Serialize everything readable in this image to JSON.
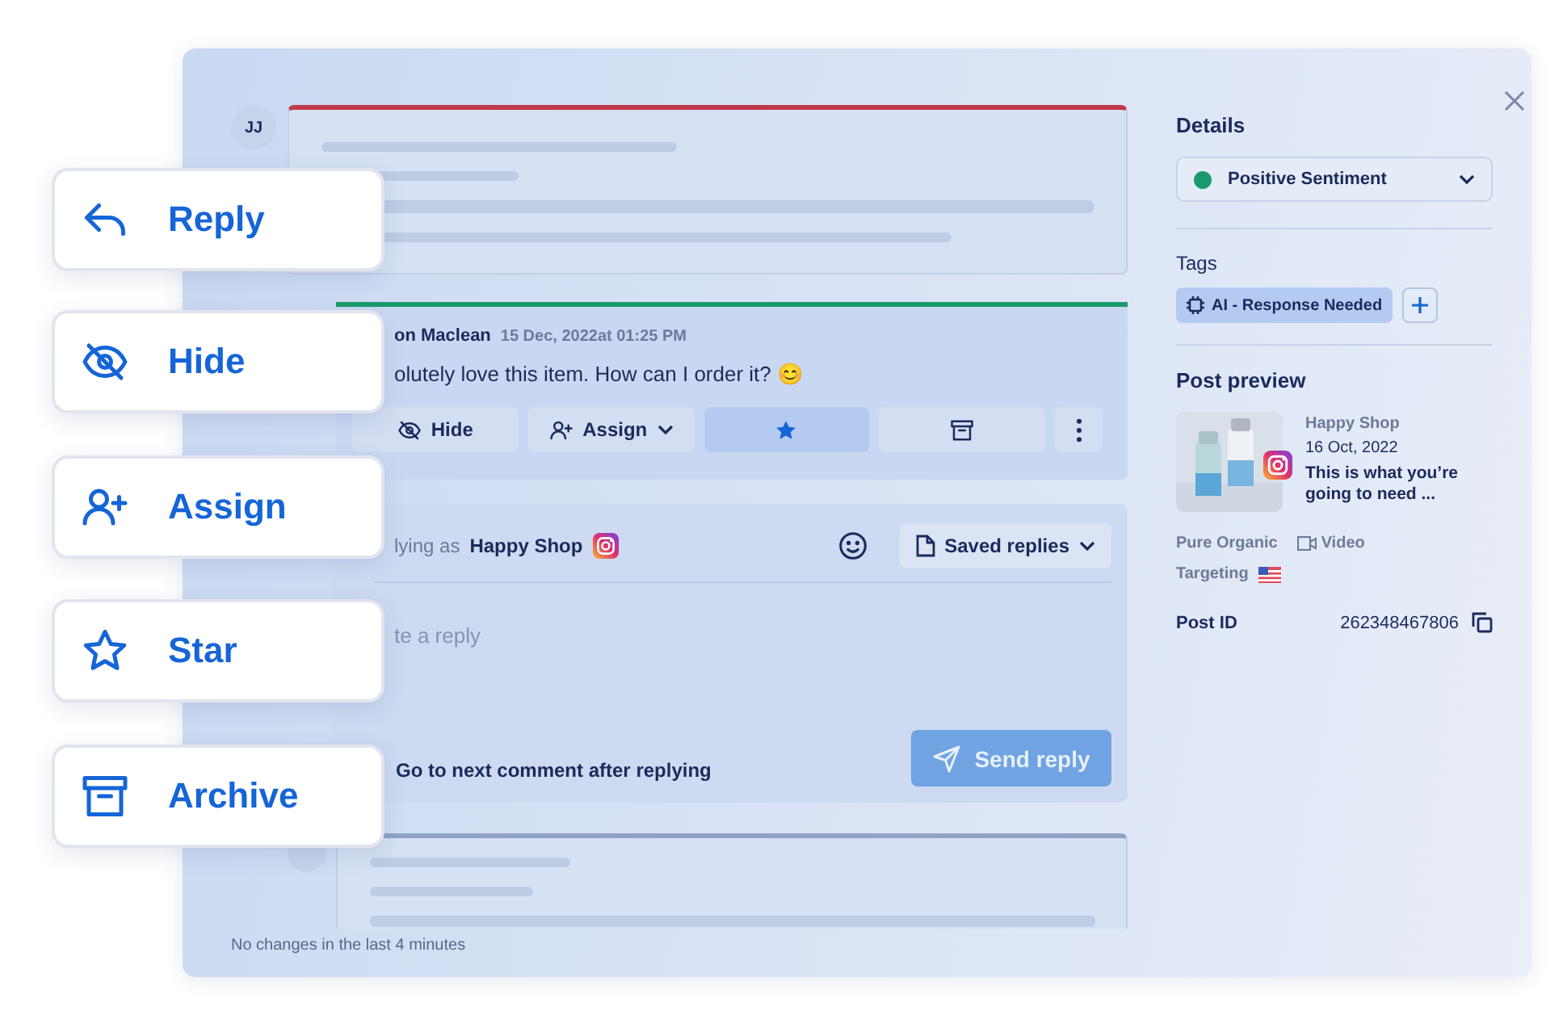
{
  "floating_actions": [
    {
      "kind": "reply",
      "label": "Reply"
    },
    {
      "kind": "hide",
      "label": "Hide"
    },
    {
      "kind": "assign",
      "label": "Assign"
    },
    {
      "kind": "star",
      "label": "Star"
    },
    {
      "kind": "archive",
      "label": "Archive"
    }
  ],
  "comments": [
    {
      "kind": "collapsed",
      "avatar": "JJ",
      "color": "#c0394b"
    },
    {
      "kind": "expanded",
      "author": "on Maclean",
      "date": "15 Dec, 2022at 01:25 PM",
      "text": "olutely love this item. How can I order it? 😊",
      "color": "#1a9a6a",
      "actions": [
        {
          "kind": "hide",
          "label": "Hide",
          "selected": false
        },
        {
          "kind": "assign",
          "label": "Assign",
          "selected": false
        },
        {
          "kind": "star",
          "selected": true
        },
        {
          "kind": "archive",
          "selected": false
        },
        {
          "kind": "more",
          "selected": false
        }
      ]
    },
    {
      "kind": "collapsed",
      "color": "#8fa3c8"
    }
  ],
  "reply": {
    "prefix": "lying as",
    "account": "Happy Shop",
    "saved_replies": "Saved replies",
    "placeholder": "te a reply",
    "next_comment_label": "Go to next comment after replying",
    "send": "Send reply"
  },
  "status_bar": "No changes in the last 4 minutes",
  "details": {
    "title": "Details",
    "sentiment": {
      "label": "Positive Sentiment",
      "color": "#1a9a6a"
    },
    "tags_title": "Tags",
    "tags": [
      {
        "label": "AI - Response Needed"
      }
    ],
    "post_preview": {
      "title": "Post preview",
      "account": "Happy Shop",
      "date": "16 Oct, 2022",
      "caption": "This is what you’re going to need ...",
      "campaign": "Pure Organic",
      "media": "Video",
      "targeting": "Targeting"
    },
    "post_id_label": "Post ID",
    "post_id": "262348467806"
  }
}
